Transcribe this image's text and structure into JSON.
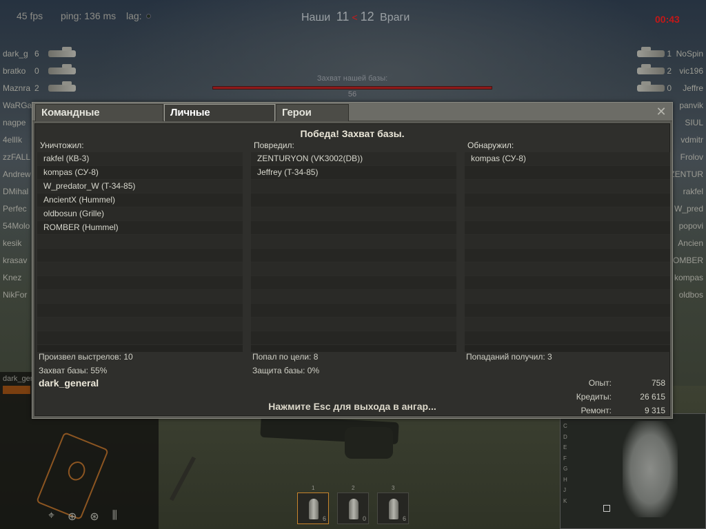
{
  "hud": {
    "fps": "45 fps",
    "ping": "ping: 136 ms",
    "lag": "lag:",
    "our_team": "Наши",
    "our_score": "11",
    "separator": "<",
    "enemy_score": "12",
    "enemy_team": "Враги",
    "timer": "00:43"
  },
  "capture": {
    "label": "Захват нашей базы:",
    "value": "56",
    "percent": 100
  },
  "team_left": [
    {
      "name": "dark_g",
      "frags": "6"
    },
    {
      "name": "bratko",
      "frags": "0"
    },
    {
      "name": "Maznra",
      "frags": "2"
    },
    {
      "name": "WaRGaS",
      "frags": ""
    },
    {
      "name": "nagpe",
      "frags": ""
    },
    {
      "name": "4ellIk",
      "frags": ""
    },
    {
      "name": "zzFALL",
      "frags": ""
    },
    {
      "name": "Andrew",
      "frags": ""
    },
    {
      "name": "DMihal",
      "frags": ""
    },
    {
      "name": "Perfec",
      "frags": ""
    },
    {
      "name": "54Molo",
      "frags": ""
    },
    {
      "name": "kesik",
      "frags": ""
    },
    {
      "name": "krasav",
      "frags": ""
    },
    {
      "name": "Knez",
      "frags": ""
    },
    {
      "name": "NikFor",
      "frags": ""
    }
  ],
  "team_right": [
    {
      "name": "NoSpin",
      "frags": "1"
    },
    {
      "name": "vic196",
      "frags": "2"
    },
    {
      "name": "Jeffre",
      "frags": "0"
    },
    {
      "name": "panvik",
      "frags": ""
    },
    {
      "name": "SIUL",
      "frags": ""
    },
    {
      "name": "vdmitr",
      "frags": ""
    },
    {
      "name": "Frolov",
      "frags": ""
    },
    {
      "name": "ZENTUR",
      "frags": ""
    },
    {
      "name": "rakfel",
      "frags": ""
    },
    {
      "name": "W_pred",
      "frags": ""
    },
    {
      "name": "popovi",
      "frags": ""
    },
    {
      "name": "Ancien",
      "frags": ""
    },
    {
      "name": "ROMBER",
      "frags": ""
    },
    {
      "name": "kompas",
      "frags": ""
    },
    {
      "name": "oldbos",
      "frags": ""
    }
  ],
  "tank_panel": {
    "player_short": "dark_gen",
    "icons": [
      "binoculars-icon",
      "crosshair-icon",
      "steering-wheel-icon",
      "extinguisher-icon"
    ]
  },
  "minimap": {
    "letters": [
      "C",
      "D",
      "E",
      "F",
      "G",
      "H",
      "J",
      "K"
    ]
  },
  "ammo": [
    {
      "slot": "1",
      "count": "6"
    },
    {
      "slot": "2",
      "count": "0"
    },
    {
      "slot": "3",
      "count": "6"
    }
  ],
  "dialog": {
    "tabs": [
      "Командные достижения",
      "Личные достижения",
      "Герои битвы"
    ],
    "active_tab": 1,
    "close": "✕",
    "result_title": "Победа! Захват базы.",
    "columns": [
      {
        "label": "Уничтожил:",
        "items": [
          "rakfel (КВ-3)",
          "kompas (СУ-8)",
          "W_predator_W (T-34-85)",
          "AncientX (Hummel)",
          "oldbosun (Grille)",
          "ROMBER (Hummel)"
        ]
      },
      {
        "label": "Повредил:",
        "items": [
          "ZENTURYON (VK3002(DB))",
          "Jeffrey (T-34-85)"
        ]
      },
      {
        "label": "Обнаружил:",
        "items": [
          "kompas (СУ-8)"
        ]
      }
    ],
    "stats": {
      "shots": "Произвел выстрелов: 10",
      "capture": "Захват базы: 55%",
      "hits": "Попал по цели: 8",
      "defense": "Защита базы: 0%",
      "hits_received": "Попаданий получил: 3"
    },
    "player_name": "dark_general",
    "esc_hint": "Нажмите Esc для выхода в ангар...",
    "rewards": [
      {
        "label": "Опыт:",
        "value": "758"
      },
      {
        "label": "Кредиты:",
        "value": "26 615"
      },
      {
        "label": "Ремонт:",
        "value": "9 315"
      }
    ]
  }
}
